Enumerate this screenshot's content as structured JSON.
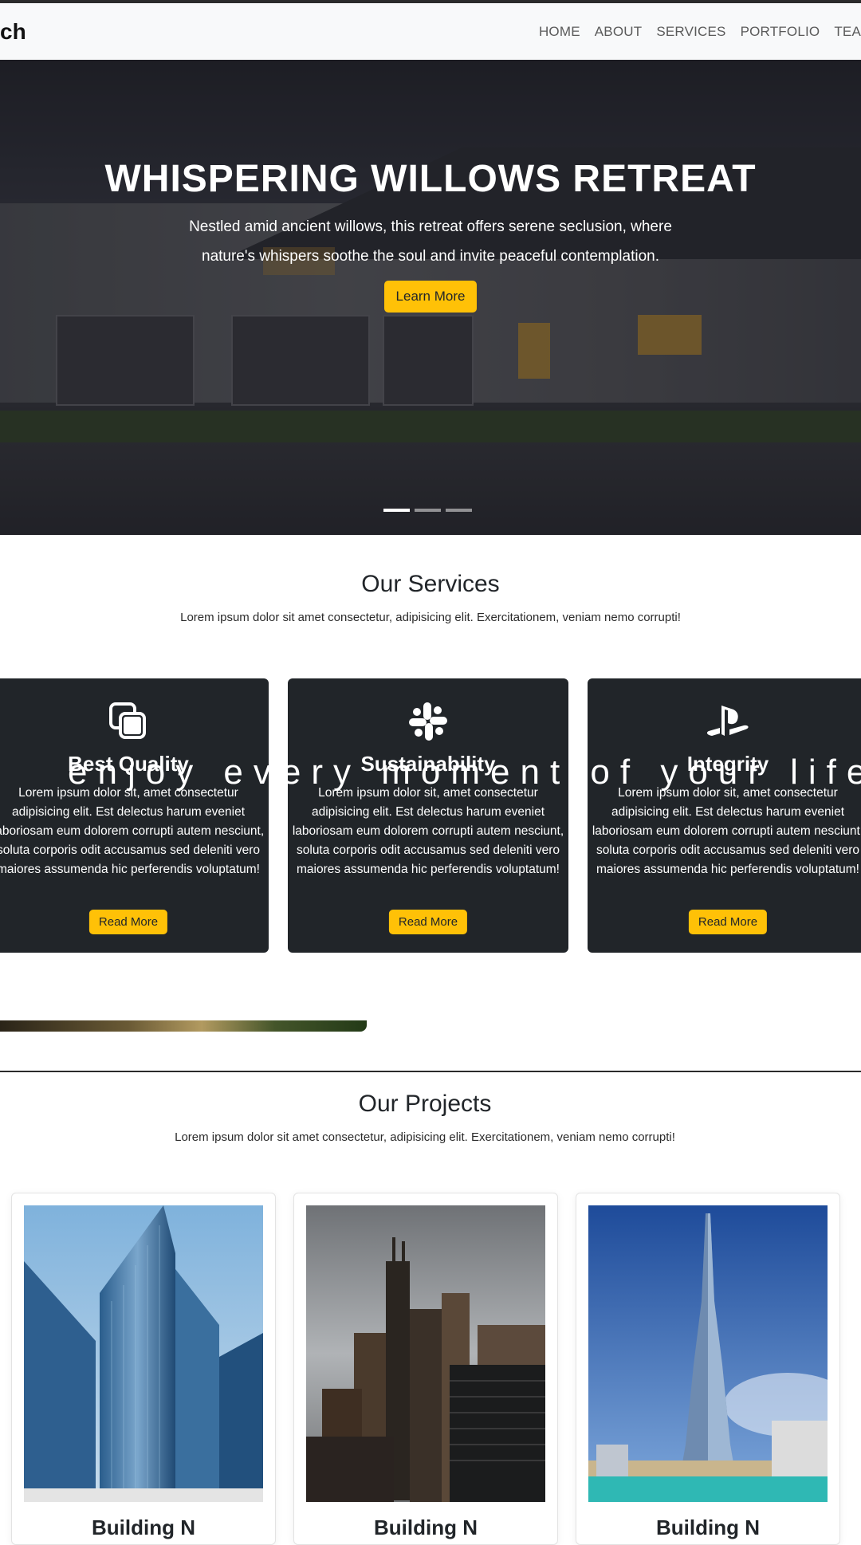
{
  "navbar": {
    "brand": "ch",
    "links": [
      "HOME",
      "ABOUT",
      "SERVICES",
      "PORTFOLIO",
      "TEA"
    ]
  },
  "hero": {
    "title": "WHISPERING WILLOWS RETREAT",
    "description": "Nestled amid ancient willows, this retreat offers serene seclusion, where nature's whispers soothe the soul and invite peaceful contemplation.",
    "button_label": "Learn More",
    "slides": 3,
    "active_slide": 1
  },
  "services": {
    "title": "Our Services",
    "subtitle": "Lorem ipsum dolor sit amet consectetur, adipisicing elit. Exercitationem, veniam nemo corrupti!",
    "cards": [
      {
        "icon": "layers-icon",
        "name": "Best Quality",
        "text": "Lorem ipsum dolor sit, amet consectetur adipisicing elit. Est delectus harum eveniet laboriosam eum dolorem corrupti autem nesciunt, soluta corporis odit accusamus sed deleniti vero maiores assumenda hic perferendis voluptatum!",
        "button": "Read More"
      },
      {
        "icon": "slack-icon",
        "name": "Sustainability",
        "text": "Lorem ipsum dolor sit, amet consectetur adipisicing elit. Est delectus harum eveniet laboriosam eum dolorem corrupti autem nesciunt, soluta corporis odit accusamus sed deleniti vero maiores assumenda hic perferendis voluptatum!",
        "button": "Read More"
      },
      {
        "icon": "playstation-icon",
        "name": "Integrity",
        "text": "Lorem ipsum dolor sit, amet consectetur adipisicing elit. Est delectus harum eveniet laboriosam eum dolorem corrupti autem nesciunt, soluta corporis odit accusamus sed deleniti vero maiores assumenda hic perferendis voluptatum!",
        "button": "Read More"
      }
    ],
    "overlay_text": "enjoy every moment of your life"
  },
  "projects": {
    "title": "Our Projects",
    "subtitle": "Lorem ipsum dolor sit amet consectetur, adipisicing elit. Exercitationem, veniam nemo corrupti!",
    "cards": [
      {
        "name": "Building N",
        "image": "glass-skyscraper-image"
      },
      {
        "name": "Building N",
        "image": "city-towers-image"
      },
      {
        "name": "Building N",
        "image": "spire-tower-image"
      }
    ]
  },
  "colors": {
    "accent": "#ffc107",
    "card_dark": "#212529",
    "navbar_bg": "#f8f9fa"
  }
}
